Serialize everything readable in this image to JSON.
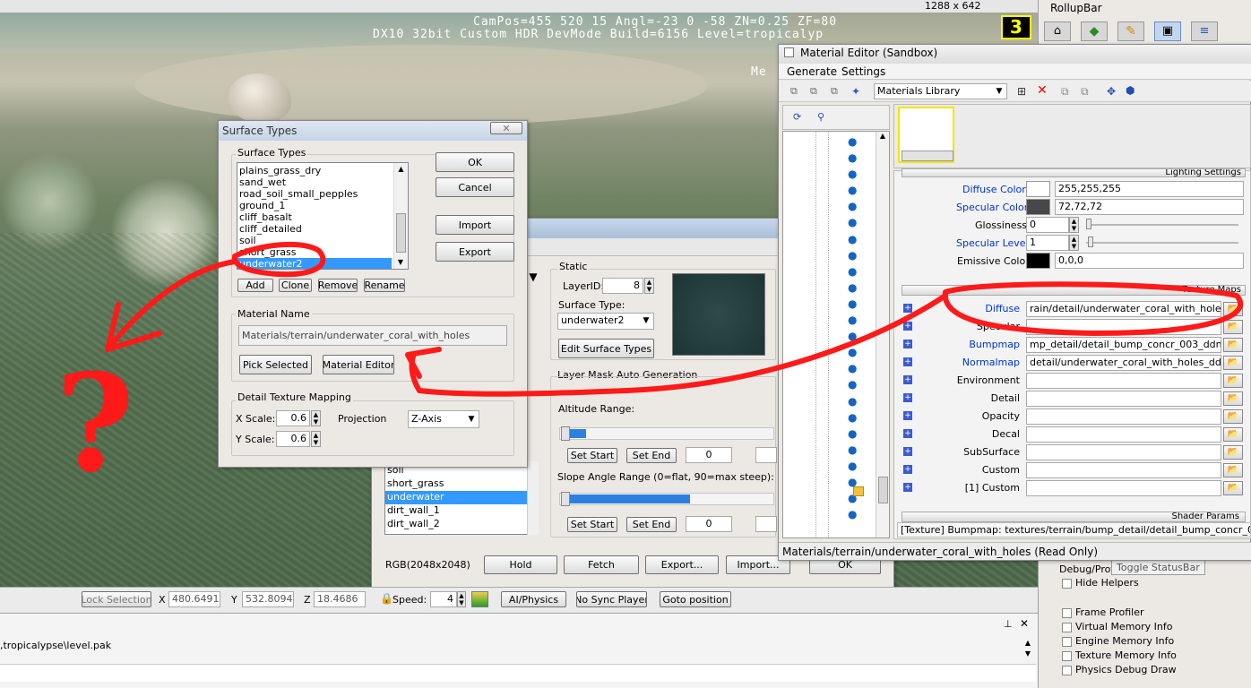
{
  "hud": {
    "line1": "CamPos=455 520  15 Angl=-23  0 -58 ZN=0.25 ZF=80",
    "line2": "DX10 32bit Custom HDR DevMode Build=6156 Level=tropicalyp",
    "mem": "Me",
    "res": "1288 x 642"
  },
  "rollup": {
    "title": "RollupBar",
    "toggle": "Toggle StatusBar",
    "debug_label": "Debug/Profi",
    "checks": [
      "Hide Helpers",
      "Frame Profiler",
      "Virtual Memory Info",
      "Engine Memory Info",
      "Texture Memory Info",
      "Physics Debug Draw"
    ]
  },
  "surface": {
    "title": "Surface Types",
    "group": "Surface Types",
    "items": [
      "plains_grass_dry",
      "sand_wet",
      "road_soil_small_pepples",
      "ground_1",
      "cliff_basalt",
      "cliff_detailed",
      "soil",
      "short_grass",
      "underwater2"
    ],
    "selected": "underwater2",
    "ok": "OK",
    "cancel": "Cancel",
    "import": "Import",
    "export": "Export",
    "add": "Add",
    "clone": "Clone",
    "remove": "Remove",
    "rename": "Rename",
    "material_group": "Material Name",
    "material_value": "Materials/terrain/underwater_coral_with_holes",
    "pick": "Pick Selected",
    "mat_editor": "Material Editor",
    "detail_group": "Detail Texture Mapping",
    "xscale_label": "X Scale:",
    "xscale": "0.6",
    "yscale_label": "Y Scale:",
    "yscale": "0.6",
    "projection_label": "Projection",
    "projection": "Z-Axis"
  },
  "layer": {
    "items": [
      "soil",
      "short_grass",
      "underwater",
      "dirt_wall_1",
      "dirt_wall_2"
    ],
    "selected": "underwater",
    "static": "Static",
    "layerid_label": "LayerID:",
    "layerid": "8",
    "surface_label": "Surface Type:",
    "surface_value": "underwater2",
    "edit_surface": "Edit Surface Types",
    "auto_gen": "Layer Mask Auto Generation",
    "altitude": "Altitude Range:",
    "set_start": "Set Start",
    "set_end": "Set End",
    "zero": "0",
    "slope": "Slope Angle Range (0=flat, 90=max steep):",
    "rgb": "RGB(2048x2048)",
    "hold": "Hold",
    "fetch": "Fetch",
    "export": "Export...",
    "import": "Import...",
    "ok": "OK"
  },
  "matedit": {
    "title": "Material Editor (Sandbox)",
    "menu": [
      "Generate",
      "Settings"
    ],
    "library": "Materials Library",
    "lighting": "Lighting Settings",
    "diffuse_color_label": "Diffuse Color",
    "diffuse_color": "255,255,255",
    "specular_color_label": "Specular Color",
    "specular_color": "72,72,72",
    "gloss_label": "Glossiness",
    "gloss": "0",
    "spec_level_label": "Specular Level",
    "spec_level": "1",
    "emissive_label": "Emissive Color",
    "emissive": "0,0,0",
    "texture_maps": "Texture Maps",
    "textures": [
      {
        "label": "Diffuse",
        "value": "rain/detail/underwater_coral_with_holes.tif",
        "blue": true
      },
      {
        "label": "Specular",
        "value": "",
        "blue": false
      },
      {
        "label": "Bumpmap",
        "value": "mp_detail/detail_bump_concr_003_ddn.dds",
        "blue": true
      },
      {
        "label": "Normalmap",
        "value": "detail/underwater_coral_with_holes_ddn.tif",
        "blue": true
      },
      {
        "label": "Environment",
        "value": "",
        "blue": false
      },
      {
        "label": "Detail",
        "value": "",
        "blue": false
      },
      {
        "label": "Opacity",
        "value": "",
        "blue": false
      },
      {
        "label": "Decal",
        "value": "",
        "blue": false
      },
      {
        "label": "SubSurface",
        "value": "",
        "blue": false
      },
      {
        "label": "Custom",
        "value": "",
        "blue": false
      },
      {
        "label": "[1] Custom",
        "value": "",
        "blue": false
      }
    ],
    "shader_params": "Shader Params",
    "info": "[Texture] Bumpmap: textures/terrain/bump_detail/detail_bump_concr_003_ddn.d",
    "status": "Materials/terrain/underwater_coral_with_holes (Read Only)"
  },
  "bottom": {
    "lock": "Lock Selection",
    "x_label": "X",
    "x": "480.6491",
    "y_label": "Y",
    "y": "532.8094",
    "z_label": "Z",
    "z": "18.4686",
    "speed_label": "Speed:",
    "speed": "4",
    "ai": "AI/Physics",
    "nosync": "No Sync Player",
    "goto": "Goto position",
    "path": ",tropicalypse\\level.pak"
  },
  "annotation": "?",
  "colors": {
    "annotation": "#ff1a1a",
    "selection": "#3399ff",
    "link": "#0033cc"
  }
}
